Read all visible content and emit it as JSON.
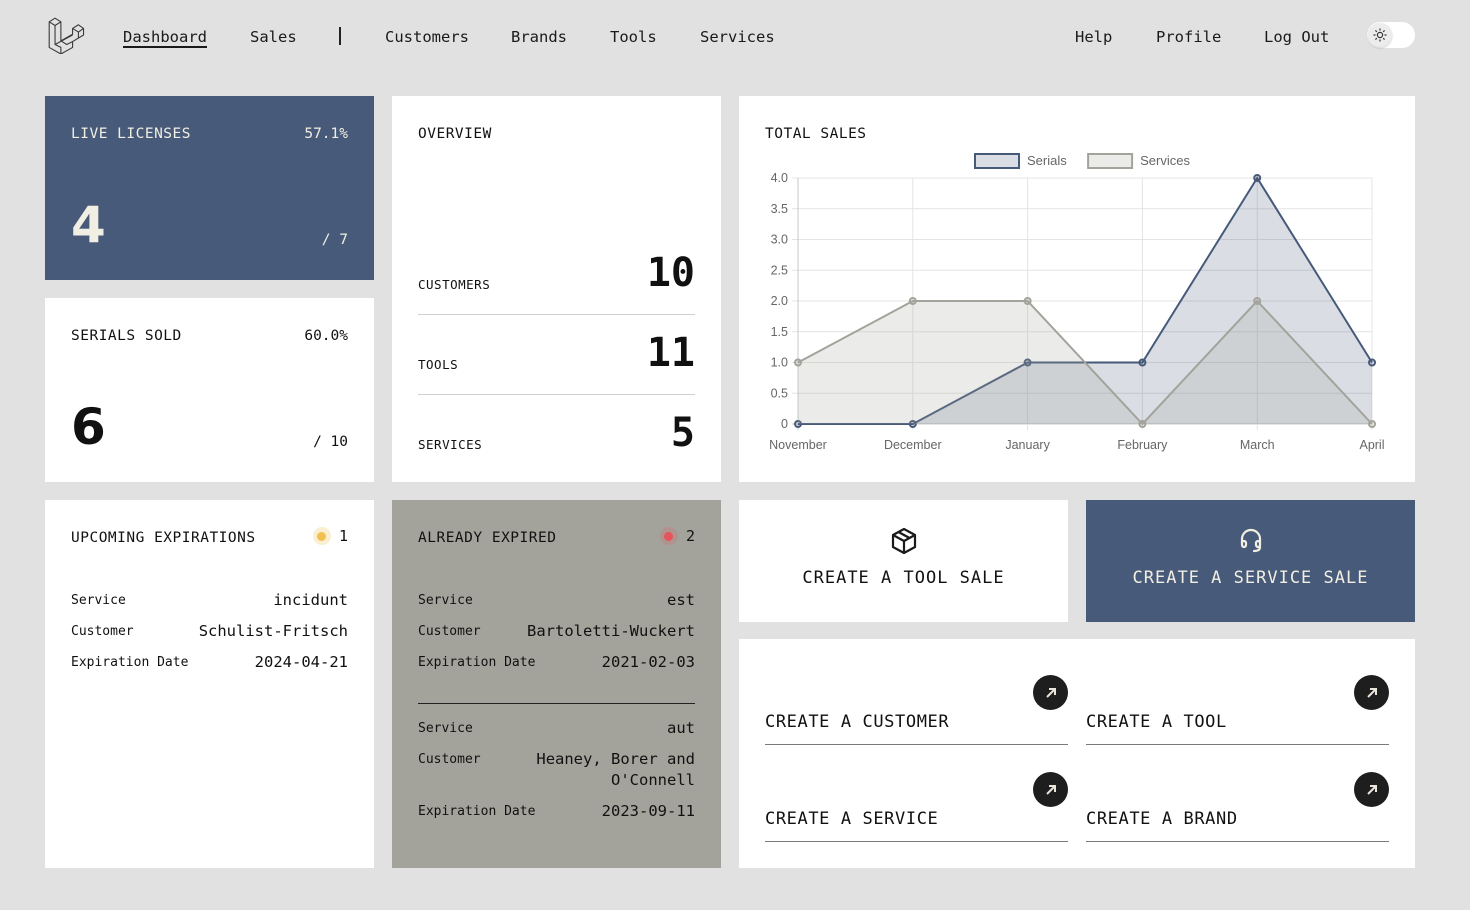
{
  "nav": {
    "left_links": [
      {
        "label": "Dashboard",
        "active": true
      },
      {
        "label": "Sales",
        "active": false
      },
      {
        "label": "Customers",
        "active": false
      },
      {
        "label": "Brands",
        "active": false
      },
      {
        "label": "Tools",
        "active": false
      },
      {
        "label": "Services",
        "active": false
      }
    ],
    "right_links": [
      {
        "label": "Help"
      },
      {
        "label": "Profile"
      },
      {
        "label": "Log Out"
      }
    ],
    "theme_toggle": {
      "icon": "sun-icon",
      "state": "light"
    }
  },
  "live_licenses": {
    "title": "LIVE LICENSES",
    "percent": "57.1%",
    "value": "4",
    "total": "/ 7"
  },
  "serials_sold": {
    "title": "SERIALS SOLD",
    "percent": "60.0%",
    "value": "6",
    "total": "/ 10"
  },
  "overview": {
    "title": "OVERVIEW",
    "rows": [
      {
        "label": "CUSTOMERS",
        "value": "10"
      },
      {
        "label": "TOOLS",
        "value": "11"
      },
      {
        "label": "SERVICES",
        "value": "5"
      }
    ]
  },
  "total_sales": {
    "title": "TOTAL SALES"
  },
  "chart_data": {
    "type": "area",
    "title": "TOTAL SALES",
    "categories": [
      "November",
      "December",
      "January",
      "February",
      "March",
      "April"
    ],
    "series": [
      {
        "name": "Serials",
        "values": [
          0,
          0,
          1,
          1,
          4,
          1
        ],
        "color": "#475a79",
        "fill": "rgba(71,90,121,0.2)"
      },
      {
        "name": "Services",
        "values": [
          1,
          2,
          2,
          0,
          2,
          0
        ],
        "color": "#a3a39b",
        "fill": "rgba(163,163,155,0.22)"
      }
    ],
    "yticks": [
      "0",
      "0.5",
      "1.0",
      "1.5",
      "2.0",
      "2.5",
      "3.0",
      "3.5",
      "4.0"
    ],
    "ylim": [
      0,
      4
    ],
    "xlabel": "",
    "ylabel": "",
    "grid": true,
    "legend": "top-center"
  },
  "upcoming_expirations": {
    "title": "UPCOMING EXPIRATIONS",
    "count": "1",
    "dot_color": "#f1c04d",
    "items": [
      {
        "service_label": "Service",
        "service": "incidunt",
        "customer_label": "Customer",
        "customer": "Schulist-Fritsch",
        "date_label": "Expiration Date",
        "date": "2024-04-21"
      }
    ]
  },
  "already_expired": {
    "title": "ALREADY EXPIRED",
    "count": "2",
    "dot_color": "#e5535b",
    "items": [
      {
        "service_label": "Service",
        "service": "est",
        "customer_label": "Customer",
        "customer": "Bartoletti-Wuckert",
        "date_label": "Expiration Date",
        "date": "2021-02-03"
      },
      {
        "service_label": "Service",
        "service": "aut",
        "customer_label": "Customer",
        "customer": "Heaney, Borer and O'Connell",
        "date_label": "Expiration Date",
        "date": "2023-09-11"
      }
    ]
  },
  "actions": {
    "tool_sale": {
      "label": "CREATE A TOOL SALE",
      "icon": "package-icon"
    },
    "service_sale": {
      "label": "CREATE A SERVICE SALE",
      "icon": "headset-icon"
    }
  },
  "quick_links": [
    {
      "label": "CREATE A CUSTOMER",
      "icon": "arrow-up-right-icon"
    },
    {
      "label": "CREATE A TOOL",
      "icon": "arrow-up-right-icon"
    },
    {
      "label": "CREATE A SERVICE",
      "icon": "arrow-up-right-icon"
    },
    {
      "label": "CREATE A BRAND",
      "icon": "arrow-up-right-icon"
    }
  ],
  "colors": {
    "primary": "#475a79",
    "background": "#e1e1e1",
    "muted_panel": "#a3a39b",
    "accent_text": "#f1efe3"
  }
}
